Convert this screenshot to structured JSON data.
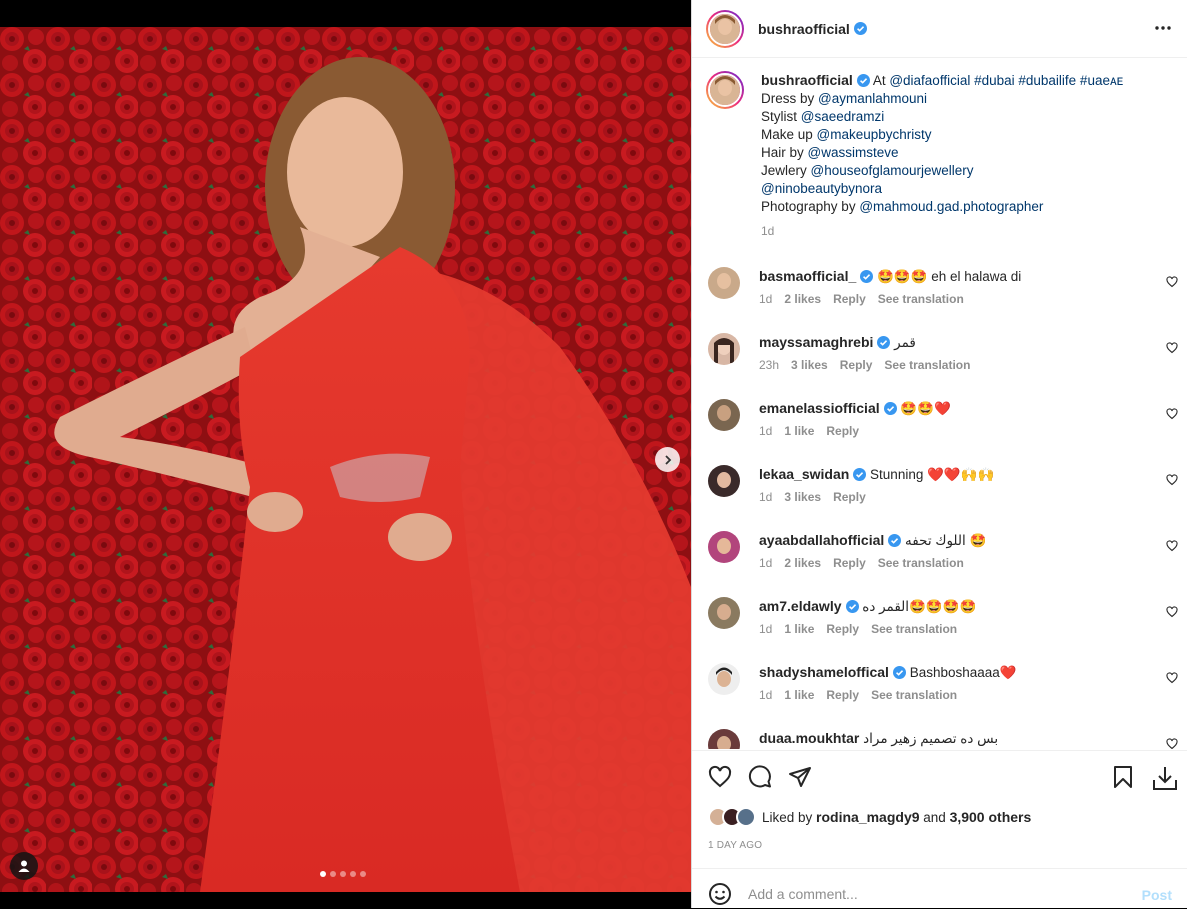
{
  "post": {
    "username": "bushraofficial",
    "more_icon": "more-options-icon",
    "image_alt": "Woman in a red one-shoulder gown posing in front of a red rose wall",
    "carousel": {
      "count": 5,
      "active": 0
    }
  },
  "caption": {
    "username": "bushraofficial",
    "at_prefix": "At ",
    "at_mention": "@diafaofficial",
    "hashtags": "#dubai #dubailife #uaeᴀᴇ",
    "dress_prefix": "Dress by ",
    "dress_mention": "@aymanlahmouni",
    "stylist_prefix": "Stylist ",
    "stylist_mention": "@saeedramzi",
    "makeup_prefix": "Make up ",
    "makeup_mention": "@makeupbychristy",
    "hair_prefix": "Hair by ",
    "hair_mention": "@wassimsteve",
    "jewelry_prefix": "Jewlery ",
    "jewelry_mention": "@houseofglamourjewellery",
    "extra_mention": "@ninobeautybynora",
    "photo_prefix": "Photography by ",
    "photo_mention": "@mahmoud.gad.photographer",
    "time": "1d"
  },
  "comments": [
    {
      "username": "basmaofficial_",
      "text": "🤩🤩🤩 eh el halawa di",
      "time": "1d",
      "likes": "2 likes",
      "reply": "Reply",
      "translate": "See translation",
      "avatar_color": "#c9a98a"
    },
    {
      "username": "mayssamaghrebi",
      "text": "قمر",
      "time": "23h",
      "likes": "3 likes",
      "reply": "Reply",
      "translate": "See translation",
      "avatar_color": "#d8b7a5"
    },
    {
      "username": "emanelassiofficial",
      "text": "🤩🤩❤️",
      "time": "1d",
      "likes": "1 like",
      "reply": "Reply",
      "translate": "",
      "avatar_color": "#7a6650"
    },
    {
      "username": "lekaa_swidan",
      "text": "Stunning ❤️❤️🙌🙌",
      "time": "1d",
      "likes": "3 likes",
      "reply": "Reply",
      "translate": "",
      "avatar_color": "#3a2a2a"
    },
    {
      "username": "ayaabdallahofficial",
      "text": "اللوك تحفه 🤩",
      "time": "1d",
      "likes": "2 likes",
      "reply": "Reply",
      "translate": "See translation",
      "avatar_color": "#b2457c"
    },
    {
      "username": "am7.eldawly",
      "text": "القمر ده🤩🤩🤩🤩",
      "time": "1d",
      "likes": "1 like",
      "reply": "Reply",
      "translate": "See translation",
      "avatar_color": "#8a7a60"
    },
    {
      "username": "shadyshameloffical",
      "text": "Bashboshaaaa❤️",
      "time": "1d",
      "likes": "1 like",
      "reply": "Reply",
      "translate": "See translation",
      "avatar_color": "#4a4a4a"
    },
    {
      "username": "duaa.moukhtar",
      "text": "بس ده تصميم زهير مراد",
      "time": "",
      "likes": "",
      "reply": "",
      "translate": "",
      "avatar_color": "#6a3b3b"
    }
  ],
  "actions": {
    "liked_prefix": "Liked by ",
    "liked_user": "rodina_magdy9",
    "liked_and": " and ",
    "liked_others": "3,900 others",
    "post_time": "1 DAY AGO"
  },
  "add_comment": {
    "placeholder": "Add a comment...",
    "post_label": "Post"
  },
  "colors": {
    "verified": "#3897f0",
    "link": "#00376b",
    "muted": "#8e8e8e",
    "post_disabled": "#b2dffc"
  }
}
